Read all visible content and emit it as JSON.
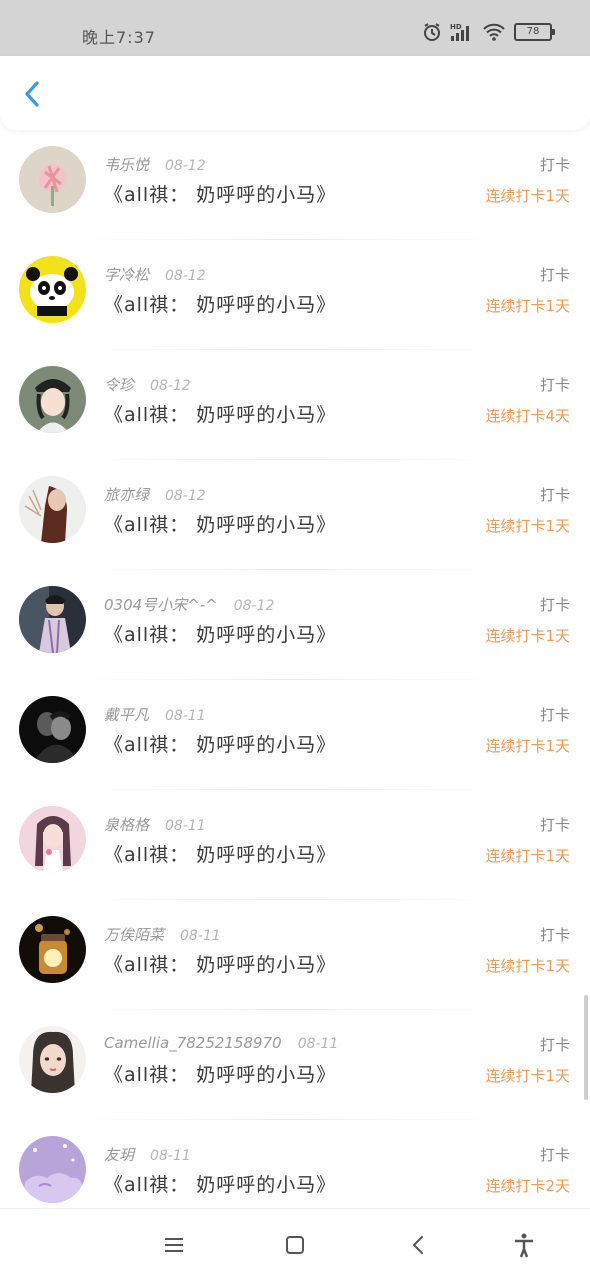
{
  "status_bar": {
    "time": "晚上7:37",
    "battery": "78",
    "icons": [
      "alarm-icon",
      "hd-signal-icon",
      "wifi-icon",
      "battery-icon"
    ]
  },
  "header": {
    "back_icon": "chevron-left-icon"
  },
  "colors": {
    "accent_blue": "#3a9ae0",
    "streak_orange": "#ef9a58",
    "status_bar_bg": "#d4d4d4"
  },
  "checkins": [
    {
      "name": "韦乐悦",
      "date": "08-12",
      "title": "《all祺： 奶呼呼的小马》",
      "action": "打卡",
      "streak": "连续打卡1天"
    },
    {
      "name": "字冷松",
      "date": "08-12",
      "title": "《all祺： 奶呼呼的小马》",
      "action": "打卡",
      "streak": "连续打卡1天"
    },
    {
      "name": "令珍",
      "date": "08-12",
      "title": "《all祺： 奶呼呼的小马》",
      "action": "打卡",
      "streak": "连续打卡4天"
    },
    {
      "name": "旅亦绿",
      "date": "08-12",
      "title": "《all祺： 奶呼呼的小马》",
      "action": "打卡",
      "streak": "连续打卡1天"
    },
    {
      "name": "0304号小宋^-^",
      "date": "08-12",
      "title": "《all祺： 奶呼呼的小马》",
      "action": "打卡",
      "streak": "连续打卡1天"
    },
    {
      "name": "戴平凡",
      "date": "08-11",
      "title": "《all祺： 奶呼呼的小马》",
      "action": "打卡",
      "streak": "连续打卡1天"
    },
    {
      "name": "泉格格",
      "date": "08-11",
      "title": "《all祺： 奶呼呼的小马》",
      "action": "打卡",
      "streak": "连续打卡1天"
    },
    {
      "name": "万俟陌菜",
      "date": "08-11",
      "title": "《all祺： 奶呼呼的小马》",
      "action": "打卡",
      "streak": "连续打卡1天"
    },
    {
      "name": "Camellia_78252158970",
      "date": "08-11",
      "title": "《all祺： 奶呼呼的小马》",
      "action": "打卡",
      "streak": "连续打卡1天"
    },
    {
      "name": "友玥",
      "date": "08-11",
      "title": "《all祺： 奶呼呼的小马》",
      "action": "打卡",
      "streak": "连续打卡2天"
    }
  ],
  "nav_bar": {
    "icons": [
      "menu-icon",
      "home-icon",
      "back-icon",
      "accessibility-icon"
    ]
  }
}
